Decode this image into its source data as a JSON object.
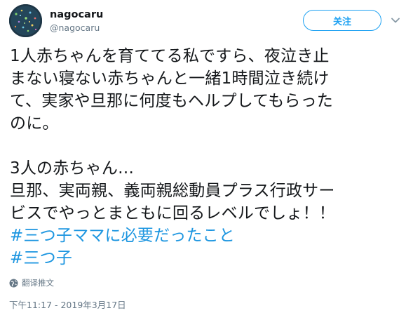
{
  "user": {
    "display_name": "nagocaru",
    "handle": "@nagocaru",
    "avatar_icon": "avatar-image"
  },
  "follow_label": "关注",
  "more_icon": "chevron-down-icon",
  "tweet": {
    "lines_1": [
      "1人赤ちゃんを育ててる私ですら、夜泣き止",
      "まない寝ない赤ちゃんと一緒1時間泣き続け",
      "て、実家や旦那に何度もヘルプしてもらった",
      "のに。"
    ],
    "lines_2": [
      "3人の赤ちゃん…",
      "旦那、実両親、義両親総動員プラス行政サー",
      "ビスでやっとまともに回るレベルでしょ！！"
    ],
    "hashtags": [
      "#三つ子ママに必要だったこと",
      "#三つ子"
    ]
  },
  "translate_label": "翻译推文",
  "translate_icon": "globe-icon",
  "timestamp": "下午11:17 - 2019年3月17日",
  "colors": {
    "link": "#1b95e0",
    "follow": "#1da1f2",
    "secondary_text": "#657786",
    "primary_text": "#14171a"
  }
}
